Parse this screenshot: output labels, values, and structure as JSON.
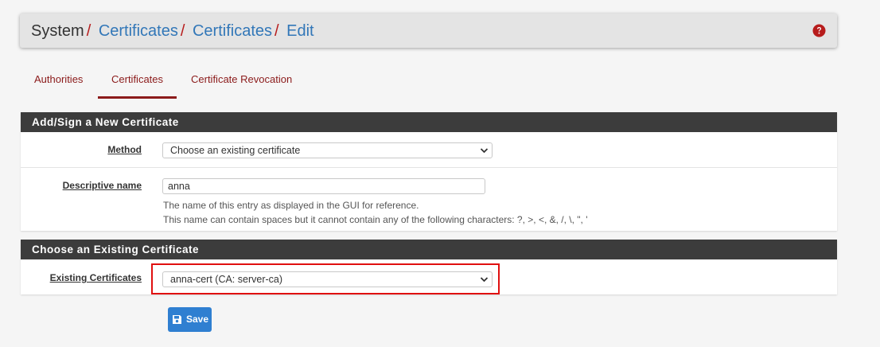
{
  "breadcrumb": {
    "root": "System",
    "separator": "/",
    "items": [
      "Certificates",
      "Certificates",
      "Edit"
    ]
  },
  "help_icon": "question-circle-icon",
  "tabs": [
    {
      "label": "Authorities",
      "active": false
    },
    {
      "label": "Certificates",
      "active": true
    },
    {
      "label": "Certificate Revocation",
      "active": false
    }
  ],
  "panel_add": {
    "title": "Add/Sign a New Certificate",
    "method_label": "Method",
    "method_value": "Choose an existing certificate",
    "descr_label": "Descriptive name",
    "descr_value": "anna",
    "descr_help_1": "The name of this entry as displayed in the GUI for reference.",
    "descr_help_2": "This name can contain spaces but it cannot contain any of the following characters: ?, >, <, &, /, \\, \", '"
  },
  "panel_existing": {
    "title": "Choose an Existing Certificate",
    "existing_label": "Existing Certificates",
    "existing_value": "anna-cert (CA: server-ca)"
  },
  "save_button": {
    "label": "Save",
    "icon": "save-icon"
  },
  "colors": {
    "accent_red": "#8b1a1a",
    "link_blue": "#3277b8",
    "panel_header": "#3c3c3c",
    "button_blue": "#2f7fd1",
    "highlight_red": "#e01010"
  }
}
